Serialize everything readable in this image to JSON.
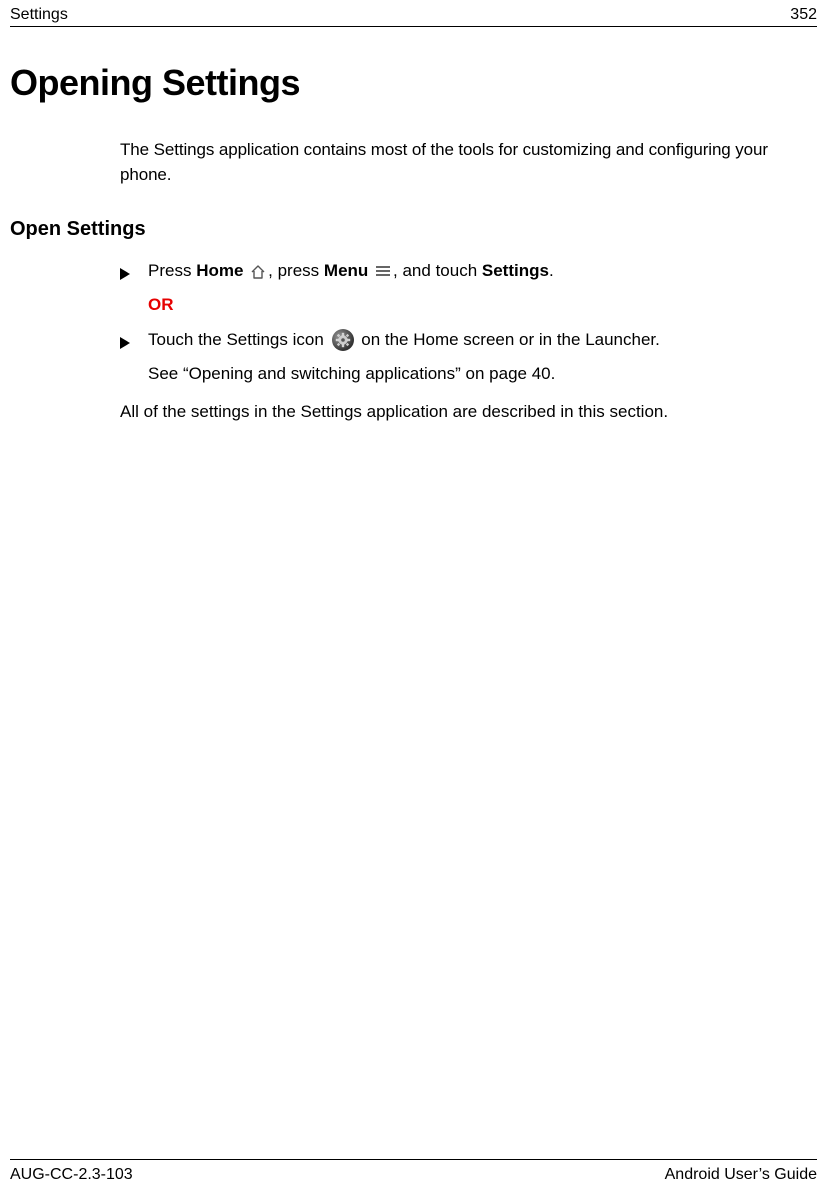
{
  "header": {
    "section": "Settings",
    "page_number": "352"
  },
  "title": "Opening Settings",
  "intro": "The Settings application contains most of the tools for customizing and configuring your phone.",
  "subheading": "Open Settings",
  "step1": {
    "t1": "Press ",
    "b1": "Home",
    "t2": ", press ",
    "b2": "Menu",
    "t3": ", and touch ",
    "b3": "Settings",
    "t4": "."
  },
  "or": "OR",
  "step2": {
    "t1": "Touch the Settings icon ",
    "t2": " on the Home screen or in the Launcher."
  },
  "see": "See “Opening and switching applications” on page 40.",
  "closing": "All of the settings in the Settings application are described in this section.",
  "footer": {
    "doc_id": "AUG-CC-2.3-103",
    "guide": "Android User’s Guide"
  }
}
